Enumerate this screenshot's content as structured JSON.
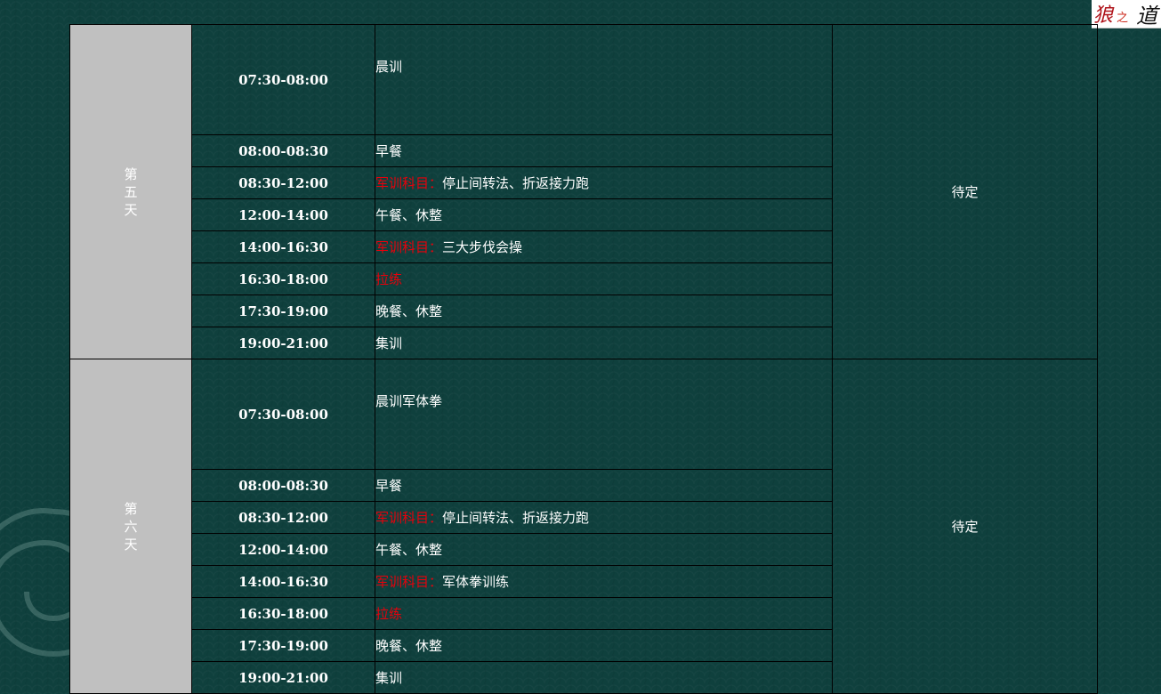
{
  "logo": {
    "text": "狼之道"
  },
  "days": [
    {
      "label_chars": [
        "第",
        "五",
        "天"
      ],
      "note": "待定",
      "rows": [
        {
          "time": "07:30-08:00",
          "prefix": "",
          "text": "晨训"
        },
        {
          "time": "08:00-08:30",
          "prefix": "",
          "text": "早餐"
        },
        {
          "time": "08:30-12:00",
          "prefix": "军训科目：",
          "text": "停止间转法、折返接力跑"
        },
        {
          "time": "12:00-14:00",
          "prefix": "",
          "text": "午餐、休整"
        },
        {
          "time": "14:00-16:30",
          "prefix": "军训科目：",
          "text": "三大步伐会操"
        },
        {
          "time": "16:30-18:00",
          "prefix": "拉练",
          "text": ""
        },
        {
          "time": "17:30-19:00",
          "prefix": "",
          "text": "晚餐、休整"
        },
        {
          "time": "19:00-21:00",
          "prefix": "",
          "text": "集训"
        }
      ]
    },
    {
      "label_chars": [
        "第",
        "六",
        "天"
      ],
      "note": "待定",
      "rows": [
        {
          "time": "07:30-08:00",
          "prefix": "",
          "text": "晨训军体拳"
        },
        {
          "time": "08:00-08:30",
          "prefix": "",
          "text": "早餐"
        },
        {
          "time": "08:30-12:00",
          "prefix": "军训科目：",
          "text": "停止间转法、折返接力跑"
        },
        {
          "time": "12:00-14:00",
          "prefix": "",
          "text": "午餐、休整"
        },
        {
          "time": "14:00-16:30",
          "prefix": "军训科目：",
          "text": "军体拳训练"
        },
        {
          "time": "16:30-18:00",
          "prefix": "拉练",
          "text": ""
        },
        {
          "time": "17:30-19:00",
          "prefix": "",
          "text": "晚餐、休整"
        },
        {
          "time": "19:00-21:00",
          "prefix": "",
          "text": "集训"
        }
      ]
    }
  ],
  "colors": {
    "background": "#0f403d",
    "day_cell": "#c0c0c0",
    "highlight": "#e8000b",
    "text": "#ffffff"
  }
}
